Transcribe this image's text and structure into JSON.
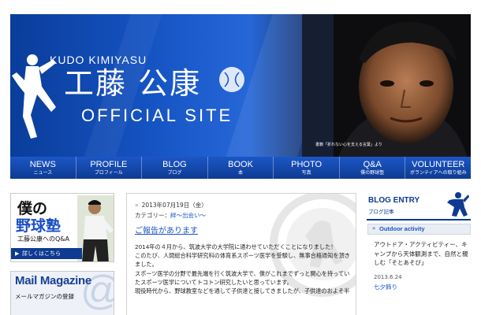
{
  "header": {
    "name_en": "KUDO KIMIYASU",
    "name_jp": "工藤 公康",
    "site_label": "OFFICIAL SITE",
    "photo_caption": "書籍「折れない心を支える言葉」より"
  },
  "nav": {
    "items": [
      {
        "en": "NEWS",
        "jp": "ニュース"
      },
      {
        "en": "PROFILE",
        "jp": "プロフィール"
      },
      {
        "en": "BLOG",
        "jp": "ブログ"
      },
      {
        "en": "BOOK",
        "jp": "本"
      },
      {
        "en": "PHOTO",
        "jp": "写真"
      },
      {
        "en": "Q&A",
        "jp": "僕の野球塾"
      },
      {
        "en": "VOLUNTEER",
        "jp": "ボランティアへの取り組み"
      }
    ]
  },
  "sidebar": {
    "banner": {
      "line1": "僕の",
      "line2": "野球塾",
      "subtitle": "工藤公康へのQ&A",
      "button_label": "詳しくはこちら",
      "button_arrow": "▶"
    },
    "mail": {
      "title": "Mail Magazine",
      "subtitle": "メールマガジンの登録",
      "at_symbol": "@"
    }
  },
  "post": {
    "arrow": "»",
    "date": "2013年07月19日（金）",
    "category_label": "カテゴリー：",
    "category_value": "絆～出会い～",
    "title": "ご報告があります",
    "body": [
      "2014年の４月から、筑波大学の大学院に通わせていただくことになりました！",
      "このたび、人間総合科学研究科の体育系スポーツ医学を受験し、無事合格通知を頂き",
      "ました。",
      "スポーツ医学の分野で最先端を行く筑波大学で、僕がこれまでずっと関心を持ってい",
      "たスポーツ医学についてトコトン研究したいと思っています。",
      "現役時代から、野球教室などを通して子供達と接してきましたが、子供達のおよそ半"
    ]
  },
  "blog": {
    "title": "BLOG ENTRY",
    "subtitle": "ブログ記事",
    "category_arrow": "»",
    "category": "Outdoor activity",
    "entry_text": "アウトドア・アクティビティー、キャンプから天体観測まで、自然と親しむ「そとあそび」",
    "entry_date": "2013.6.24",
    "entry_title": "七夕飾り"
  },
  "colors": {
    "brand_blue": "#0e3a92",
    "link_blue": "#1a55c4",
    "nav_top": "#1c57c6"
  }
}
